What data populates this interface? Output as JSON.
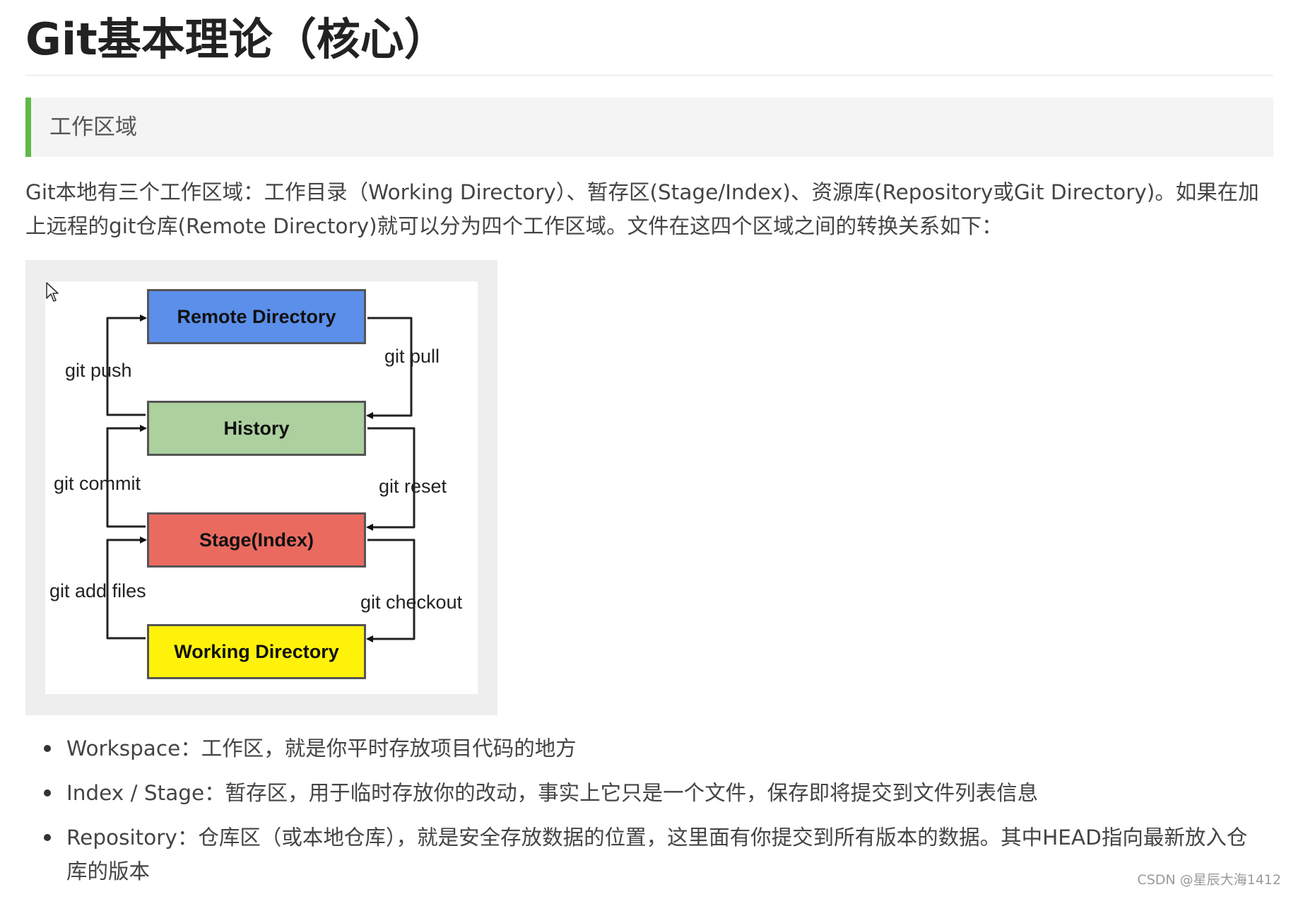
{
  "page": {
    "title": "Git基本理论（核心）"
  },
  "section": {
    "heading": "工作区域"
  },
  "intro": {
    "text": "Git本地有三个工作区域：工作目录（Working Directory）、暂存区(Stage/Index)、资源库(Repository或Git Directory)。如果在加上远程的git仓库(Remote Directory)就可以分为四个工作区域。文件在这四个区域之间的转换关系如下："
  },
  "diagram": {
    "boxes": {
      "remote": "Remote Directory",
      "history": "History",
      "stage": "Stage(Index)",
      "working": "Working Directory"
    },
    "commands": {
      "push": "git push",
      "pull": "git pull",
      "commit": "git commit",
      "reset": "git reset",
      "add": "git add files",
      "checkout": "git checkout"
    },
    "colors": {
      "remote": "#5b8fea",
      "history": "#acd09e",
      "stage": "#ea6a60",
      "working": "#fff20a"
    },
    "icons": {
      "cursor": "mouse-pointer-icon"
    }
  },
  "bullets": [
    {
      "text": "Workspace：工作区，就是你平时存放项目代码的地方"
    },
    {
      "text": "Index / Stage：暂存区，用于临时存放你的改动，事实上它只是一个文件，保存即将提交到文件列表信息"
    },
    {
      "text": "Repository：仓库区（或本地仓库），就是安全存放数据的位置，这里面有你提交到所有版本的数据。其中HEAD指向最新放入仓库的版本"
    }
  ],
  "watermark": {
    "text": "CSDN @星辰大海1412"
  },
  "theme": {
    "accent": "#5fb848",
    "quote_background": "#f4f4f4",
    "text": "#444444"
  }
}
